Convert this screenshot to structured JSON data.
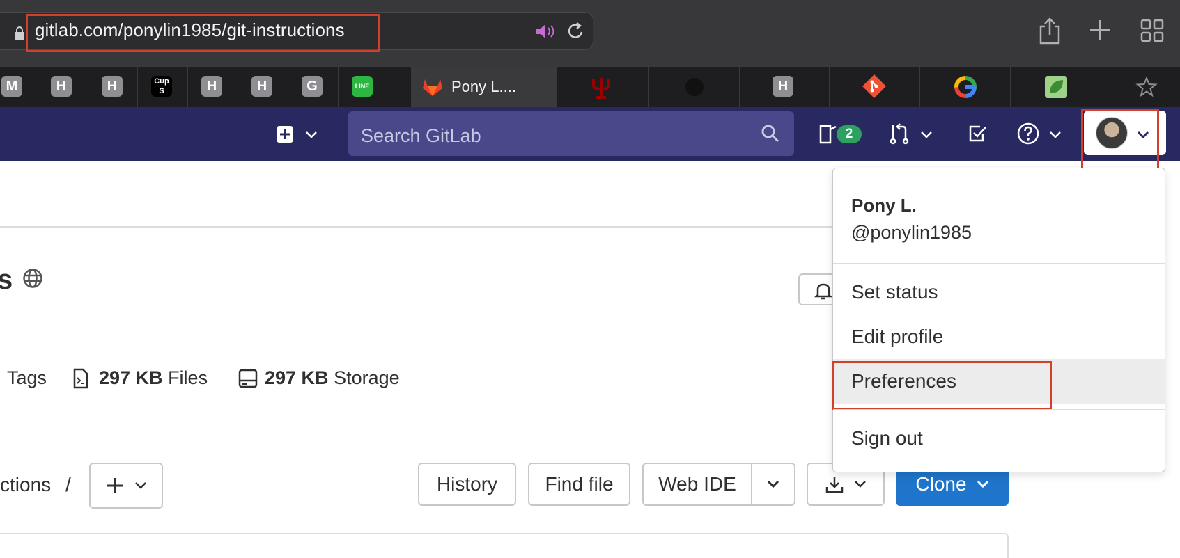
{
  "browser": {
    "url": "gitlab.com/ponylin1985/git-instructions",
    "active_tab_title": "Pony L....",
    "favicons": [
      "M",
      "H",
      "H",
      "Cup S",
      "H",
      "H",
      "G",
      "LINE"
    ],
    "favicons_right": [
      "IU",
      "dark",
      "H",
      "git",
      "G",
      "leaf"
    ]
  },
  "gitlab_nav": {
    "search_placeholder": "Search GitLab",
    "issues_badge": "2"
  },
  "project": {
    "title_fragment": "s",
    "stats": {
      "tags_label": "Tags",
      "files_size": "297 KB",
      "files_label": "Files",
      "storage_size": "297 KB",
      "storage_label": "Storage"
    },
    "breadcrumb": "ctions",
    "breadcrumb_sep": "/",
    "buttons": {
      "history": "History",
      "find_file": "Find file",
      "web_ide": "Web IDE",
      "clone": "Clone"
    }
  },
  "user_menu": {
    "name": "Pony L.",
    "handle": "@ponylin1985",
    "items": [
      "Set status",
      "Edit profile",
      "Preferences",
      "Sign out"
    ]
  },
  "colors": {
    "gitlab_nav_bg": "#292961",
    "highlight_red": "#d43f2b",
    "clone_blue": "#1f75cb"
  }
}
